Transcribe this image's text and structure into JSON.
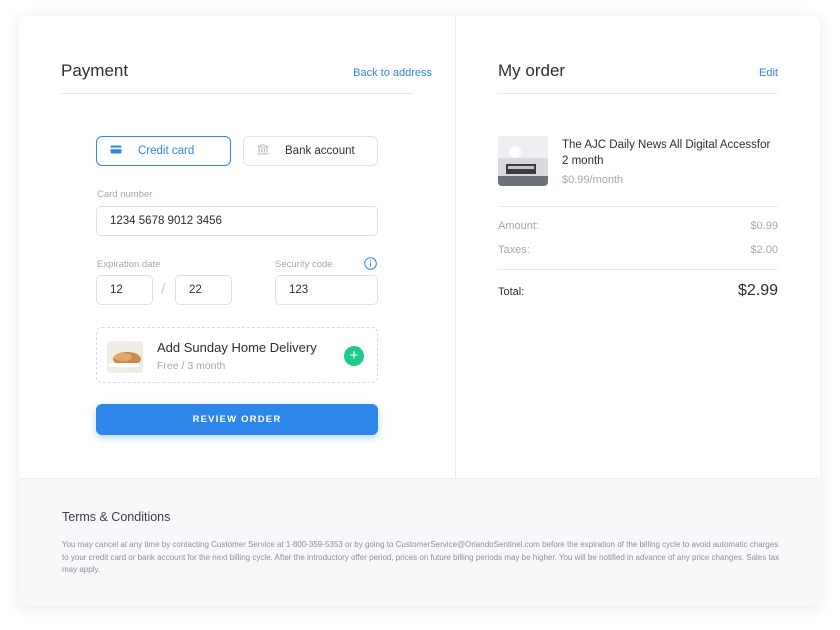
{
  "payment": {
    "title": "Payment",
    "back_link": "Back to address",
    "tabs": [
      {
        "label": "Credit card",
        "icon": "credit-card-icon",
        "active": true
      },
      {
        "label": "Bank account",
        "icon": "bank-icon",
        "active": false
      }
    ],
    "card_number": {
      "label": "Card number",
      "value": "1234 5678 9012 3456"
    },
    "expiration": {
      "label": "Expiration date",
      "month": "12",
      "year": "22"
    },
    "security": {
      "label": "Security code",
      "value": "123"
    },
    "addon": {
      "title": "Add Sunday Home Delivery",
      "subtitle": "Free / 3 month"
    },
    "review_button": "REVIEW ORDER"
  },
  "order": {
    "title": "My order",
    "edit_link": "Edit",
    "product": {
      "title": "The AJC Daily News All Digital Accessfor 2 month",
      "price": "$0.99/month"
    },
    "amount": {
      "label": "Amount:",
      "value": "$0.99"
    },
    "taxes": {
      "label": "Taxes:",
      "value": "$2.00"
    },
    "total": {
      "label": "Total:",
      "value": "$2.99"
    }
  },
  "terms": {
    "title": "Terms & Conditions",
    "text": "You may cancel at any time by contacting Customer Service at 1-800-359-5353 or by going to CustomerService@OrlandoSentinel.com before the expiration of the billing cycle to avoid automatic charges to your credit card or bank account for the next billing cycle. After the introductory offer period, prices on future billing periods may be higher. You will be notified in advance of any price changes. Sales tax may apply."
  },
  "colors": {
    "accent": "#2f86ea",
    "add_button": "#1ec98a",
    "muted_text": "#a2a8b1",
    "footer_bg": "#f7f8fa"
  }
}
